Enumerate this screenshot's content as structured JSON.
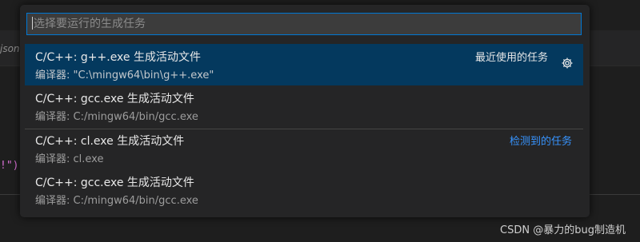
{
  "quick_pick": {
    "placeholder": "选择要运行的生成任务",
    "items": [
      {
        "label": "C/C++: g++.exe 生成活动文件",
        "detail": "编译器: \"C:\\mingw64\\bin\\g++.exe\"",
        "group": "最近使用的任务",
        "selected": true,
        "action_icon": "gear-icon"
      },
      {
        "label": "C/C++: gcc.exe 生成活动文件",
        "detail": "编译器: C:/mingw64/bin/gcc.exe",
        "group": "",
        "selected": false
      },
      {
        "label": "C/C++: cl.exe 生成活动文件",
        "detail": "编译器: cl.exe",
        "group": "检测到的任务",
        "group_color": "#3794ff",
        "selected": false
      },
      {
        "label": "C/C++: gcc.exe 生成活动文件",
        "detail": "编译器: C:/mingw64/bin/gcc.exe",
        "group": "",
        "selected": false
      }
    ]
  },
  "editor_fragments": {
    "json_text": "json",
    "code_text": "!\")"
  },
  "watermark": "CSDN @暴力的bug制造机",
  "colors": {
    "selection": "#04395e",
    "focus_border": "#0078d4",
    "link_blue": "#3794ff",
    "panel": "#252526"
  }
}
